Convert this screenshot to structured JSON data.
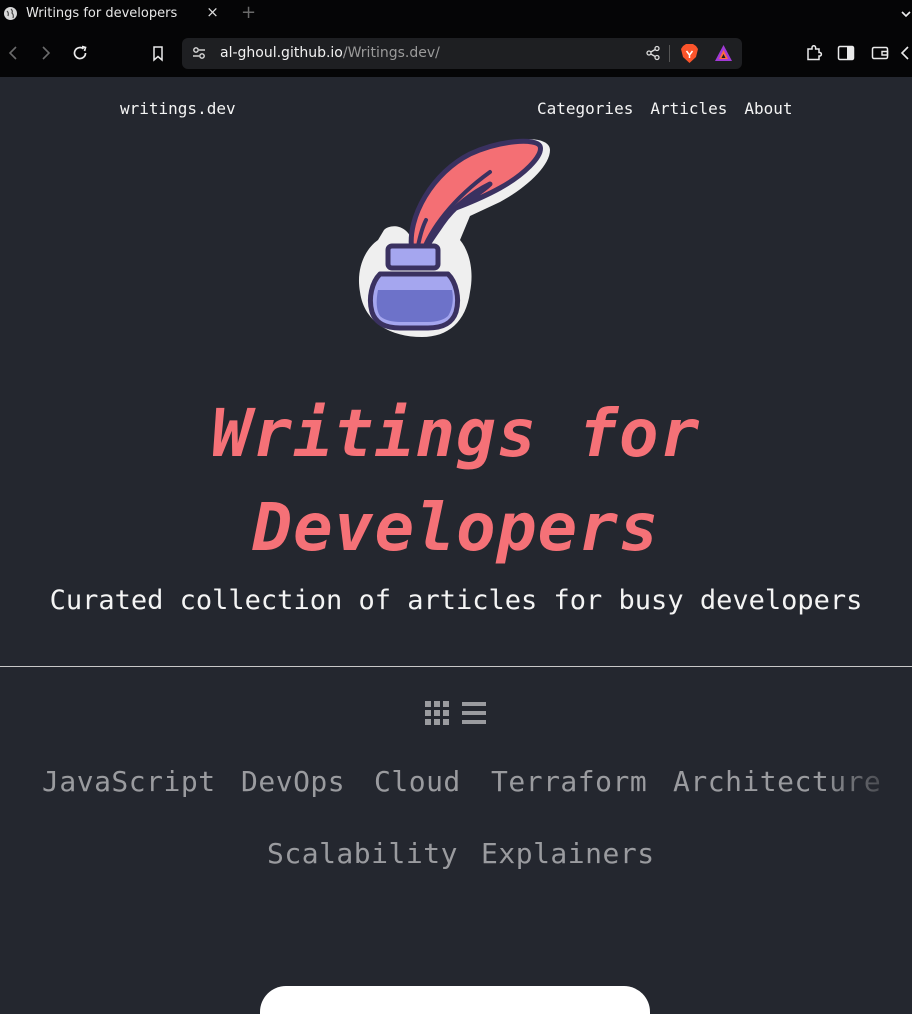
{
  "browser": {
    "tab_title": "Writings for developers",
    "tab_close": "×",
    "new_tab": "+",
    "url_host": "al-ghoul.github.io",
    "url_path": "/Writings.dev/"
  },
  "site": {
    "brand": "writings.dev",
    "nav": [
      "Categories",
      "Articles",
      "About"
    ],
    "hero_title_line1": "Writings for",
    "hero_title_line2": "Developers",
    "subtitle": "Curated collection of articles for busy developers",
    "categories": [
      "JavaScript",
      "DevOps",
      "Cloud",
      "Terraform",
      "Architecture",
      "Scalability",
      "Explainers"
    ]
  },
  "colors": {
    "page_bg": "#24272f",
    "accent": "#f57177",
    "category_text": "#9a9b9f",
    "ink_bottle": "#8f90e0"
  },
  "icons": {
    "view_grid": "grid-view-icon",
    "view_list": "list-view-icon",
    "logo": "quill-inkwell-logo"
  }
}
